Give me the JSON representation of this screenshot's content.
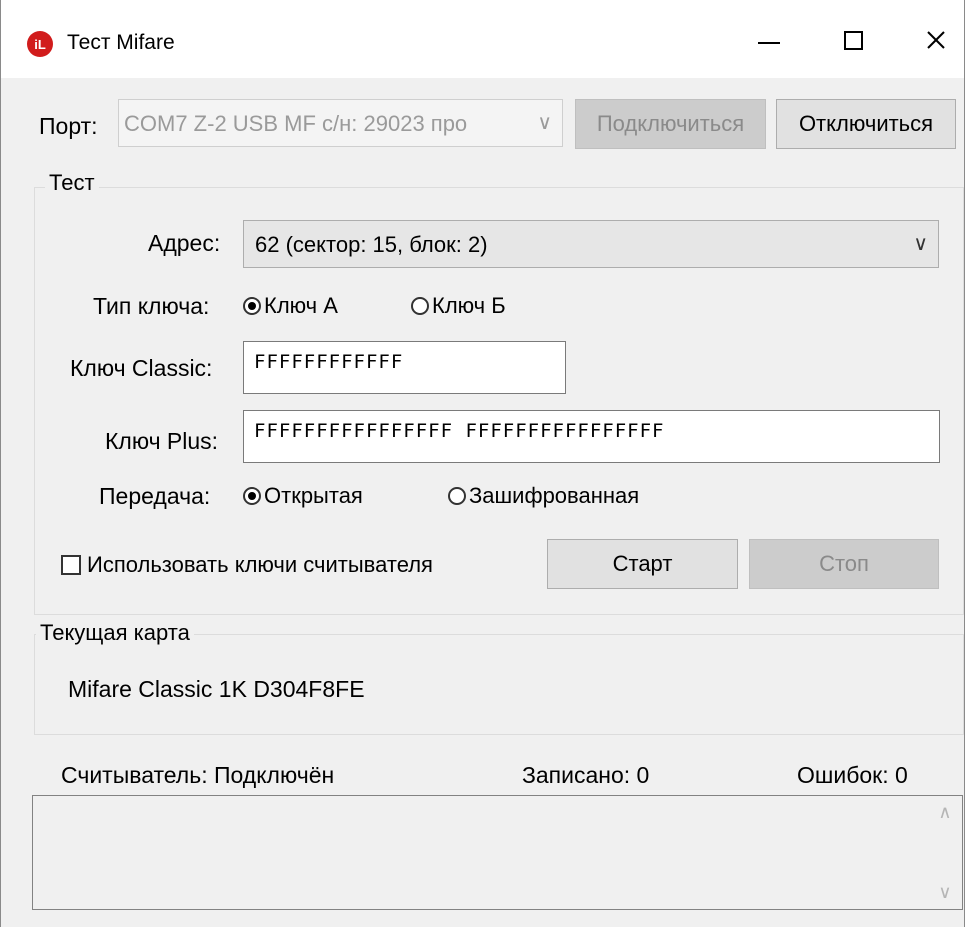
{
  "window": {
    "title": "Тест Mifare",
    "icon_text": "iL",
    "controls": {
      "minimize": "—",
      "maximize": "",
      "close": "✕"
    }
  },
  "port": {
    "label": "Порт:",
    "value": "COM7  Z-2 USB MF с/н: 29023 про",
    "arrow": "∨",
    "connect_label": "Подключиться",
    "disconnect_label": "Отключиться"
  },
  "test": {
    "title": "Тест",
    "address_label": "Адрес:",
    "address_value": "62 (сектор: 15, блок:  2)",
    "address_arrow": "∨",
    "key_type_label": "Тип ключа:",
    "key_type_options": [
      {
        "label": "Ключ А",
        "checked": true
      },
      {
        "label": "Ключ Б",
        "checked": false
      }
    ],
    "classic_key_label": "Ключ Classic:",
    "classic_key_value": "FFFFFFFFFFFF",
    "plus_key_label": "Ключ Plus:",
    "plus_key_value": "FFFFFFFFFFFFFFFF FFFFFFFFFFFFFFFF",
    "transfer_label": "Передача:",
    "transfer_options": [
      {
        "label": "Открытая",
        "checked": true
      },
      {
        "label": "Зашифрованная",
        "checked": false
      }
    ],
    "use_reader_keys_label": "Использовать ключи считывателя",
    "use_reader_keys_checked": false,
    "start_label": "Старт",
    "stop_label": "Стоп"
  },
  "current_card": {
    "title": "Текущая карта",
    "value": "Mifare Classic 1K D304F8FE"
  },
  "status": {
    "reader": "Считыватель: Подключён",
    "written": "Записано:  0",
    "errors": "Ошибок: 0"
  },
  "log": {
    "scroll_up": "∧",
    "scroll_down": "∨"
  }
}
